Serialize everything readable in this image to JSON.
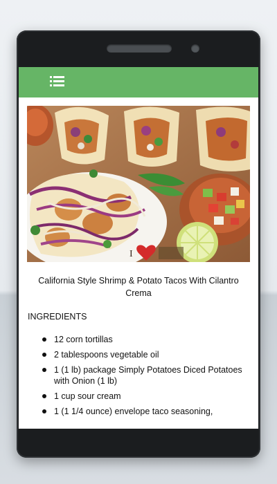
{
  "appbar": {
    "menu_icon": "list-menu-icon",
    "color": "#66b566"
  },
  "recipe": {
    "image_icon": "tacos-photo",
    "title": "California Style Shrimp & Potato Tacos With Cilantro Crema",
    "ingredients_heading": "INGREDIENTS",
    "ingredients": [
      "12 corn tortillas",
      "2 tablespoons vegetable oil",
      "1 (1 lb) package Simply Potatoes Diced Potatoes with Onion (1 lb)",
      "1 cup sour cream",
      "1 (1 1/4 ounce) envelope taco seasoning,"
    ]
  }
}
